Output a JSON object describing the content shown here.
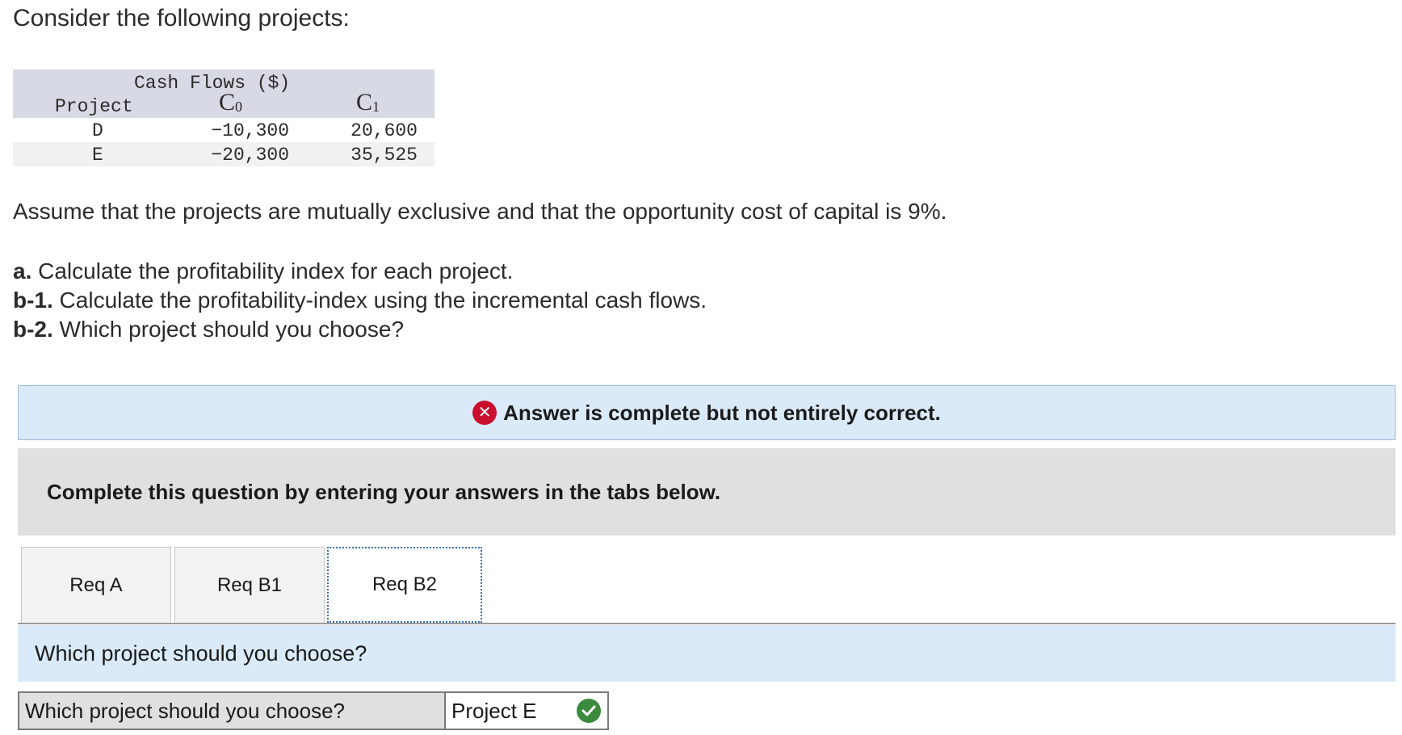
{
  "intro": "Consider the following projects:",
  "cash_flow_table": {
    "group_header": "Cash Flows ($)",
    "project_header": "Project",
    "col0": {
      "letter": "C",
      "sub": "0"
    },
    "col1": {
      "letter": "C",
      "sub": "1"
    },
    "rows": [
      {
        "project": "D",
        "c0": "−10,300",
        "c1": "20,600"
      },
      {
        "project": "E",
        "c0": "−20,300",
        "c1": "35,525"
      }
    ]
  },
  "assumption": "Assume that the projects are mutually exclusive and that the opportunity cost of capital is 9%.",
  "questions": [
    {
      "label": "a.",
      "text": " Calculate the profitability index for each project."
    },
    {
      "label": "b-1.",
      "text": " Calculate the profitability-index using the incremental cash flows."
    },
    {
      "label": "b-2.",
      "text": " Which project should you choose?"
    }
  ],
  "result": {
    "icon": "x-icon",
    "text": "Answer is complete but not entirely correct.",
    "color": "#c8102e"
  },
  "instruction": "Complete this question by entering your answers in the tabs below.",
  "tabs": [
    {
      "label": "Req A",
      "active": false
    },
    {
      "label": "Req B1",
      "active": false
    },
    {
      "label": "Req B2",
      "active": true
    }
  ],
  "question_band": "Which project should you choose?",
  "answer": {
    "label": "Which project should you choose?",
    "value": "Project E",
    "status_icon": "check-icon",
    "status_color": "#3b8a3e"
  }
}
